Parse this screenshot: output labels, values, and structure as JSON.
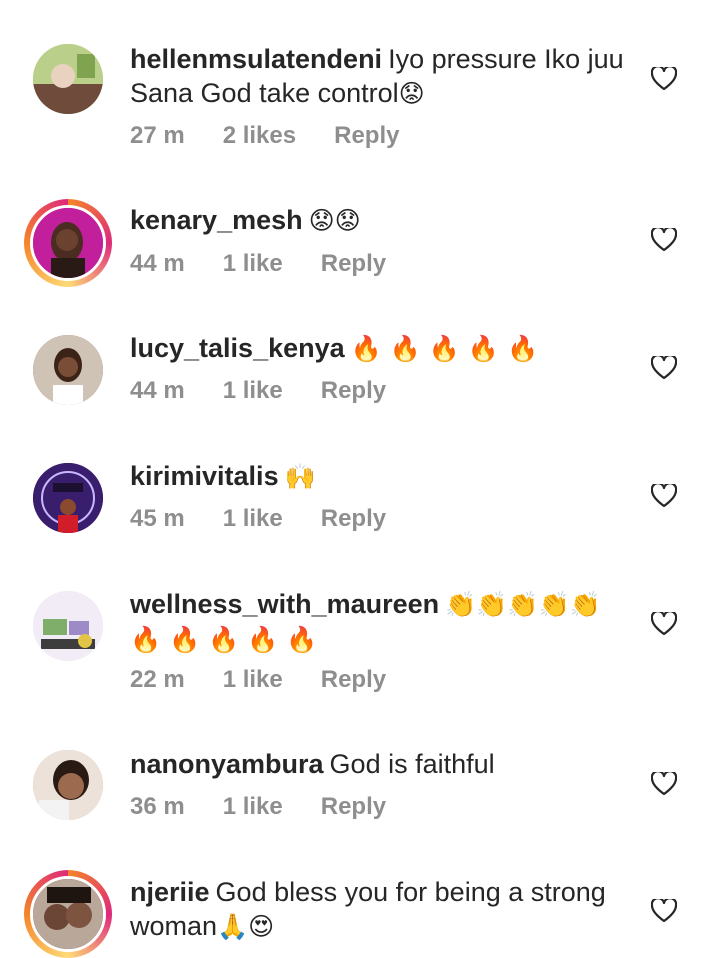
{
  "comments": [
    {
      "username": "hellenmsulatendeni",
      "text": "Iyo pressure Iko juu Sana God take control",
      "emoji": "😟",
      "time": "27 m",
      "likes": "2 likes",
      "reply": "Reply",
      "story_ring": false,
      "avatar_color": "#a5c07a"
    },
    {
      "username": "kenary_mesh",
      "text": "",
      "emoji": "😟😟",
      "time": "44 m",
      "likes": "1 like",
      "reply": "Reply",
      "story_ring": true,
      "avatar_color": "#c21f9c"
    },
    {
      "username": "lucy_talis_kenya",
      "text": "",
      "emoji": "🔥 🔥 🔥 🔥 🔥",
      "time": "44 m",
      "likes": "1 like",
      "reply": "Reply",
      "story_ring": false,
      "avatar_color": "#8a6b55"
    },
    {
      "username": "kirimivitalis",
      "text": "",
      "emoji": "🙌",
      "time": "45 m",
      "likes": "1 like",
      "reply": "Reply",
      "story_ring": false,
      "avatar_color": "#3a1e6e"
    },
    {
      "username": "wellness_with_maureen",
      "text": "",
      "emoji": "👏👏👏👏👏 🔥 🔥 🔥 🔥 🔥",
      "time": "22 m",
      "likes": "1 like",
      "reply": "Reply",
      "story_ring": false,
      "avatar_color": "#e7e0ef"
    },
    {
      "username": "nanonyambura",
      "text": "God is faithful",
      "emoji": "",
      "time": "36 m",
      "likes": "1 like",
      "reply": "Reply",
      "story_ring": false,
      "avatar_color": "#c79a7f"
    },
    {
      "username": "njeriie",
      "text": "God bless you for being a strong woman",
      "emoji": "🙏😍",
      "time": "",
      "likes": "",
      "reply": "",
      "story_ring": true,
      "avatar_color": "#6b4636"
    }
  ]
}
